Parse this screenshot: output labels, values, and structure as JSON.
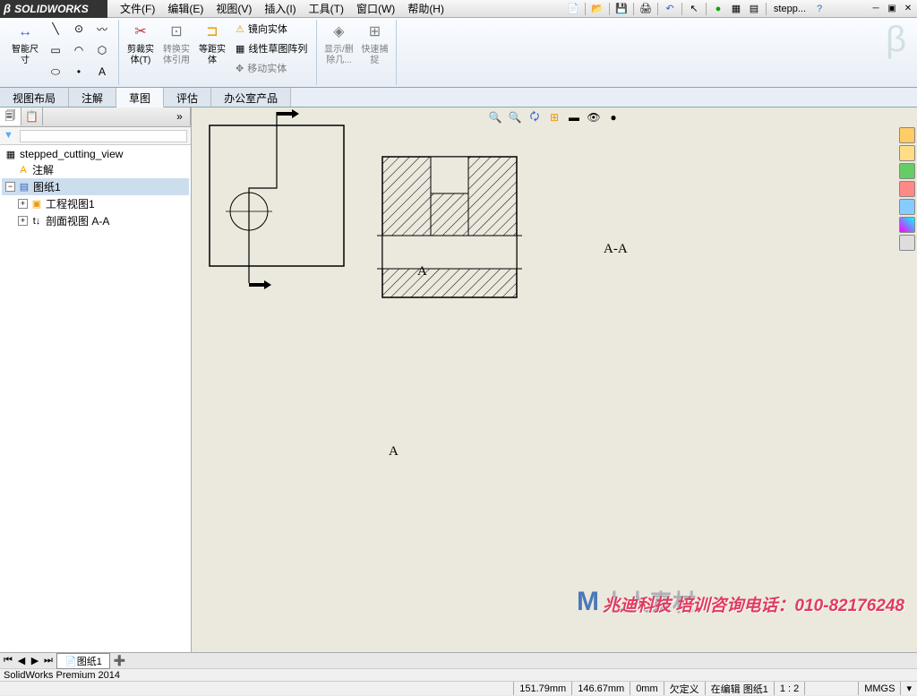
{
  "app": {
    "name": "SOLIDWORKS",
    "doc": "stepp..."
  },
  "menus": [
    "文件(F)",
    "编辑(E)",
    "视图(V)",
    "插入(I)",
    "工具(T)",
    "窗口(W)",
    "帮助(H)"
  ],
  "ribbon": {
    "smart_dim": "智能尺寸",
    "trim": "剪裁实体(T)",
    "convert": "转换实体引用",
    "offset": "等距实体",
    "mirror": "镜向实体",
    "pattern": "线性草图阵列",
    "move": "移动实体",
    "show_hide": "显示/删除几...",
    "quick_snap": "快速捕捉"
  },
  "tabs": [
    "视图布局",
    "注解",
    "草图",
    "评估",
    "办公室产品"
  ],
  "active_tab": "草图",
  "tree": {
    "root": "stepped_cutting_view",
    "annot": "注解",
    "sheet": "图纸1",
    "view1": "工程视图1",
    "section": "剖面视图 A-A"
  },
  "section_label": "A-A",
  "marker": "A",
  "sheet_tab": "图纸1",
  "status": {
    "product": "SolidWorks Premium 2014",
    "x": "151.79mm",
    "y": "146.67mm",
    "z": "0mm",
    "def": "欠定义",
    "edit": "在编辑 图纸1",
    "scale": "1 : 2",
    "units": "MMGS"
  },
  "watermark": "兆迪科技 培训咨询电话：010-82176248",
  "wm_brand": "人人素材"
}
